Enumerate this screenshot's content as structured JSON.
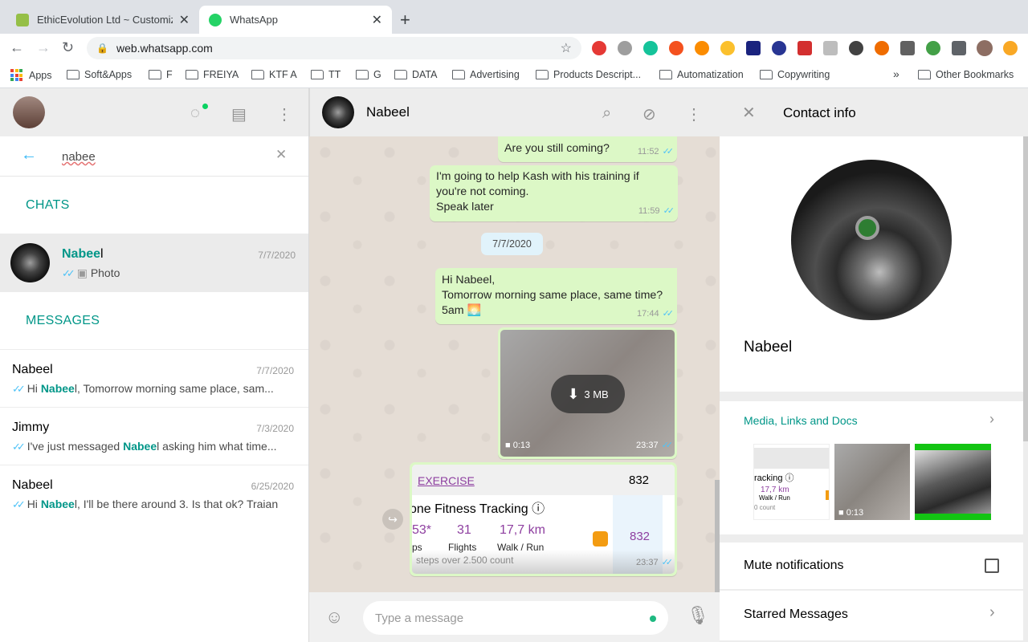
{
  "browser": {
    "tabs": [
      {
        "title": "EthicEvolution Ltd ~ Customize",
        "active": false,
        "favicon_color": "#95bf47"
      },
      {
        "title": "WhatsApp",
        "active": true,
        "favicon_color": "#25d366"
      }
    ],
    "url": "web.whatsapp.com",
    "bookmarks": [
      "Apps",
      "Soft&Apps",
      "F",
      "FREIYA",
      "KTF A",
      "TT",
      "G",
      "DATA",
      "Advertising",
      "Products Descript...",
      "Automatization",
      "Copywriting"
    ],
    "overflow": "»",
    "other_bookmarks": "Other Bookmarks"
  },
  "sidebar": {
    "search_value": "nabee",
    "chats_header": "CHATS",
    "messages_header": "MESSAGES",
    "chat": {
      "name_hl": "Nabee",
      "name_rest": "l",
      "date": "7/7/2020",
      "preview": "Photo"
    },
    "messages": [
      {
        "name": "Nabeel",
        "date": "7/7/2020",
        "pre": "Hi ",
        "hl": "Nabee",
        "post": "l, Tomorrow morning same place, sam..."
      },
      {
        "name": "Jimmy",
        "date": "7/3/2020",
        "pre": "I've just messaged ",
        "hl": "Nabee",
        "post": "l asking him what time..."
      },
      {
        "name": "Nabeel",
        "date": "6/25/2020",
        "pre": "Hi ",
        "hl": "Nabee",
        "post": "l, I'll be there around 3. Is that ok? Traian"
      }
    ]
  },
  "conversation": {
    "contact_name": "Nabeel",
    "messages": [
      {
        "lines": [
          "Are you still coming?"
        ],
        "time": "11:52"
      },
      {
        "lines": [
          "I'm going to help Kash with his training if",
          "you're not coming.",
          "Speak later"
        ],
        "time": "11:59"
      },
      {
        "lines": [
          "Hi Nabeel,",
          "Tomorrow morning same place, same time?",
          "5am 🌅"
        ],
        "time": "17:44"
      }
    ],
    "date_chip": "7/7/2020",
    "video": {
      "size": "3 MB",
      "duration": "0:13",
      "time": "23:37"
    },
    "exercise": {
      "title": "EXERCISE",
      "value": "832",
      "app": "one Fitness Tracking ⓘ",
      "steps": "53*",
      "steps_label": "ps",
      "flights": "31",
      "flights_label": "Flights",
      "distance": "17,7 km",
      "distance_label": "Walk / Run",
      "total": "832",
      "footnote": "steps over 2.500 count",
      "time": "23:37"
    },
    "input_placeholder": "Type a message"
  },
  "contact_info": {
    "title": "Contact info",
    "name": "Nabeel",
    "media_label": "Media, Links and Docs",
    "thumb1": {
      "line1": "racking ⓘ",
      "line2": "17,7 km",
      "line3": "Walk / Run",
      "line4": "0 count"
    },
    "thumb2_duration": "0:13",
    "mute_label": "Mute notifications",
    "starred_label": "Starred Messages"
  },
  "colors": {
    "accent": "#009688",
    "bubble": "#dcf8c6",
    "ticks": "#4fc3f7"
  }
}
